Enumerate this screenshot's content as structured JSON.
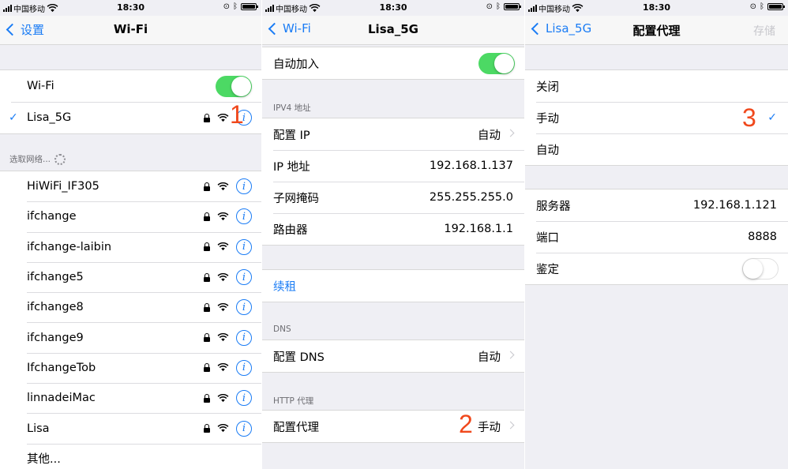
{
  "status_bar": {
    "carrier": "中国移动",
    "time": "18:30"
  },
  "screen1": {
    "back": "设置",
    "title": "Wi-Fi",
    "wifi_label": "Wi-Fi",
    "wifi_on": true,
    "connected_network": "Lisa_5G",
    "choose_label": "选取网络...",
    "networks": [
      "HiWiFi_IF305",
      "ifchange",
      "ifchange-laibin",
      "ifchange5",
      "ifchange8",
      "ifchange9",
      "IfchangeTob",
      "linnadeiMac",
      "Lisa"
    ],
    "other": "其他...",
    "marker": "1"
  },
  "screen2": {
    "back": "Wi-Fi",
    "title": "Lisa_5G",
    "auto_join": "自动加入",
    "ipv4_header": "IPV4 地址",
    "ip_rows": [
      {
        "label": "配置 IP",
        "value": "自动"
      },
      {
        "label": "IP 地址",
        "value": "192.168.1.137"
      },
      {
        "label": "子网掩码",
        "value": "255.255.255.0"
      },
      {
        "label": "路由器",
        "value": "192.168.1.1"
      }
    ],
    "renew": "续租",
    "dns_header": "DNS",
    "dns_label": "配置 DNS",
    "dns_value": "自动",
    "proxy_header": "HTTP 代理",
    "proxy_label": "配置代理",
    "proxy_value": "手动",
    "marker": "2"
  },
  "screen3": {
    "back": "Lisa_5G",
    "title": "配置代理",
    "save": "存储",
    "options": [
      "关闭",
      "手动",
      "自动"
    ],
    "selected_option": "手动",
    "server_label": "服务器",
    "server_value": "192.168.1.121",
    "port_label": "端口",
    "port_value": "8888",
    "auth_label": "鉴定",
    "auth_on": false,
    "marker": "3"
  },
  "colors": {
    "accent": "#1a7cf5",
    "toggle_on": "#4cd964",
    "marker": "#f0481c"
  }
}
